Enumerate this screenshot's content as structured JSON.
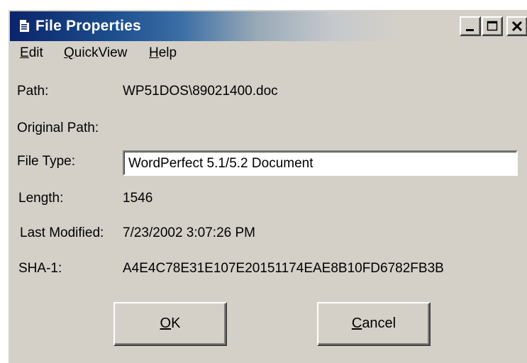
{
  "window": {
    "title": "File Properties",
    "title_icon": "document-icon",
    "controls": [
      "minimize-icon",
      "maximize-icon",
      "close-icon"
    ],
    "gradient_start": "#0a246a"
  },
  "menu": {
    "items": [
      {
        "label_u": "E",
        "label_rest": "dit"
      },
      {
        "label_u": "Q",
        "label_rest": "uickView"
      },
      {
        "label_u": "H",
        "label_rest": "elp"
      }
    ]
  },
  "fields": {
    "path": {
      "label": "Path:",
      "value": "WP51DOS\\89021400.doc"
    },
    "original_path": {
      "label": "Original Path:",
      "value": ""
    },
    "file_type": {
      "label": "File Type:",
      "value": "WordPerfect 5.1/5.2 Document"
    },
    "length": {
      "label": "Length:",
      "value": "1546"
    },
    "last_modified": {
      "label": "Last Modified:",
      "value": "7/23/2002 3:07:26 PM"
    },
    "sha1": {
      "label": "SHA-1:",
      "value": "A4E4C78E31E107E20151174EAE8B10FD6782FB3B"
    }
  },
  "buttons": {
    "ok": {
      "label_u": "O",
      "label_rest": "K"
    },
    "cancel": {
      "label_u": "C",
      "label_rest": "ancel"
    }
  }
}
